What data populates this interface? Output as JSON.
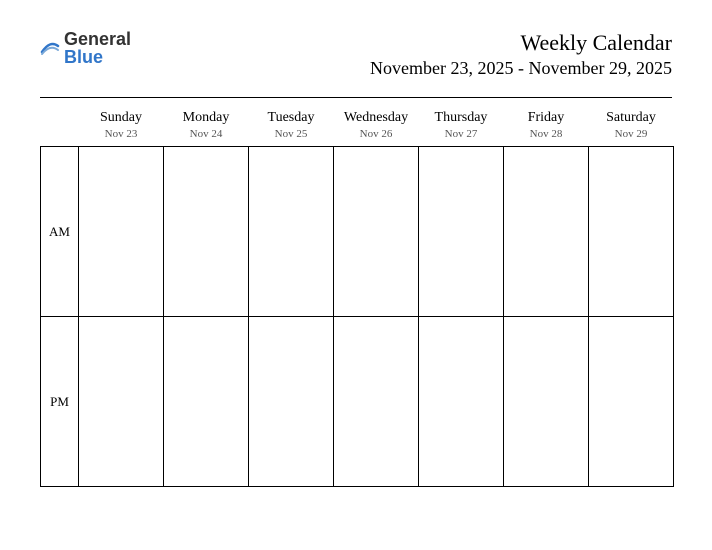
{
  "logo": {
    "word1": "General",
    "word2": "Blue"
  },
  "header": {
    "title": "Weekly Calendar",
    "date_range": "November 23, 2025 - November 29, 2025"
  },
  "days": [
    {
      "name": "Sunday",
      "date": "Nov 23"
    },
    {
      "name": "Monday",
      "date": "Nov 24"
    },
    {
      "name": "Tuesday",
      "date": "Nov 25"
    },
    {
      "name": "Wednesday",
      "date": "Nov 26"
    },
    {
      "name": "Thursday",
      "date": "Nov 27"
    },
    {
      "name": "Friday",
      "date": "Nov 28"
    },
    {
      "name": "Saturday",
      "date": "Nov 29"
    }
  ],
  "periods": {
    "am": "AM",
    "pm": "PM"
  }
}
